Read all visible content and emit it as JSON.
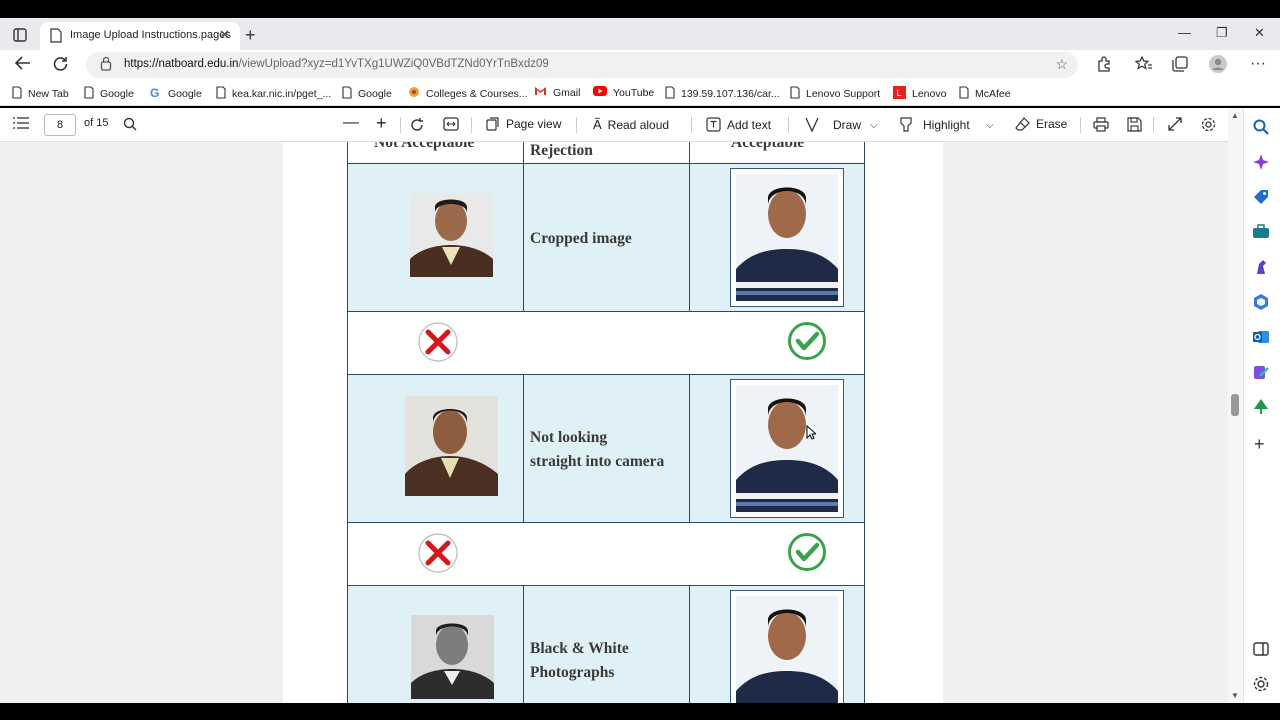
{
  "browser": {
    "tab_title": "Image Upload Instructions.pages",
    "url_host": "https://natboard.edu.in",
    "url_path": "/viewUpload?xyz=d1YvTXg1UWZiQ0VBdTZNd0YrTnBxdz09"
  },
  "bookmarks": [
    {
      "label": "New Tab",
      "icon": "page-icon"
    },
    {
      "label": "Google",
      "icon": "page-icon"
    },
    {
      "label": "Google",
      "icon": "google-icon"
    },
    {
      "label": "kea.kar.nic.in/pget_...",
      "icon": "page-icon"
    },
    {
      "label": "Google",
      "icon": "page-icon"
    },
    {
      "label": "Colleges & Courses...",
      "icon": "colleges-icon"
    },
    {
      "label": "Gmail",
      "icon": "gmail-icon"
    },
    {
      "label": "YouTube",
      "icon": "youtube-icon"
    },
    {
      "label": "139.59.107.136/car...",
      "icon": "page-icon"
    },
    {
      "label": "Lenovo Support",
      "icon": "page-icon"
    },
    {
      "label": "Lenovo",
      "icon": "lenovo-icon"
    },
    {
      "label": "McAfee",
      "icon": "page-icon"
    }
  ],
  "pdf_toolbar": {
    "page_number": "8",
    "page_total": "of 15",
    "page_view": "Page view",
    "read_aloud": "Read aloud",
    "add_text": "Add text",
    "draw": "Draw",
    "highlight": "Highlight",
    "erase": "Erase"
  },
  "document": {
    "header_left": "Not Acceptable",
    "header_middle": "Rejection",
    "header_right": "Acceptable",
    "rows": [
      {
        "reason_line1": "Cropped image",
        "reason_line2": ""
      },
      {
        "reason_line1": "Not looking",
        "reason_line2": "straight into camera"
      },
      {
        "reason_line1": "Black & White",
        "reason_line2": "Photographs"
      }
    ]
  },
  "colors": {
    "table_blue": "#dff0f7",
    "cross_red": "#d9151b",
    "check_green": "#3aa34a"
  }
}
